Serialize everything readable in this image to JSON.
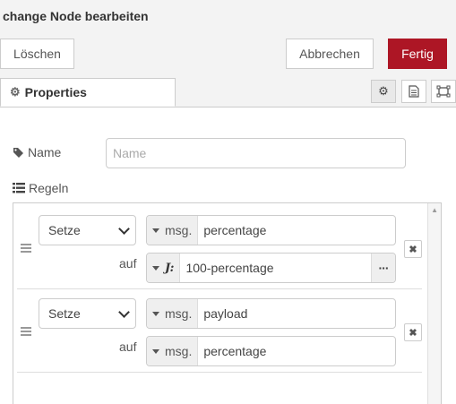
{
  "header": {
    "title": "change Node bearbeiten"
  },
  "toolbar": {
    "delete_label": "Löschen",
    "cancel_label": "Abbrechen",
    "done_label": "Fertig",
    "done_color": "#ad1625"
  },
  "tabs": {
    "properties_label": "Properties",
    "icons": [
      "gear-icon",
      "description-icon",
      "appearance-icon"
    ]
  },
  "form": {
    "name_label": "Name",
    "name_placeholder": "Name",
    "name_value": "",
    "rules_label": "Regeln"
  },
  "rules": [
    {
      "action": "Setze",
      "target": {
        "type": "msg.",
        "value": "percentage"
      },
      "to_label": "auf",
      "source": {
        "type": "J:",
        "value": "100-percentage",
        "more": "···"
      }
    },
    {
      "action": "Setze",
      "target": {
        "type": "msg.",
        "value": "payload"
      },
      "to_label": "auf",
      "source": {
        "type": "msg.",
        "value": "percentage"
      }
    }
  ],
  "delete_glyph": "✖"
}
